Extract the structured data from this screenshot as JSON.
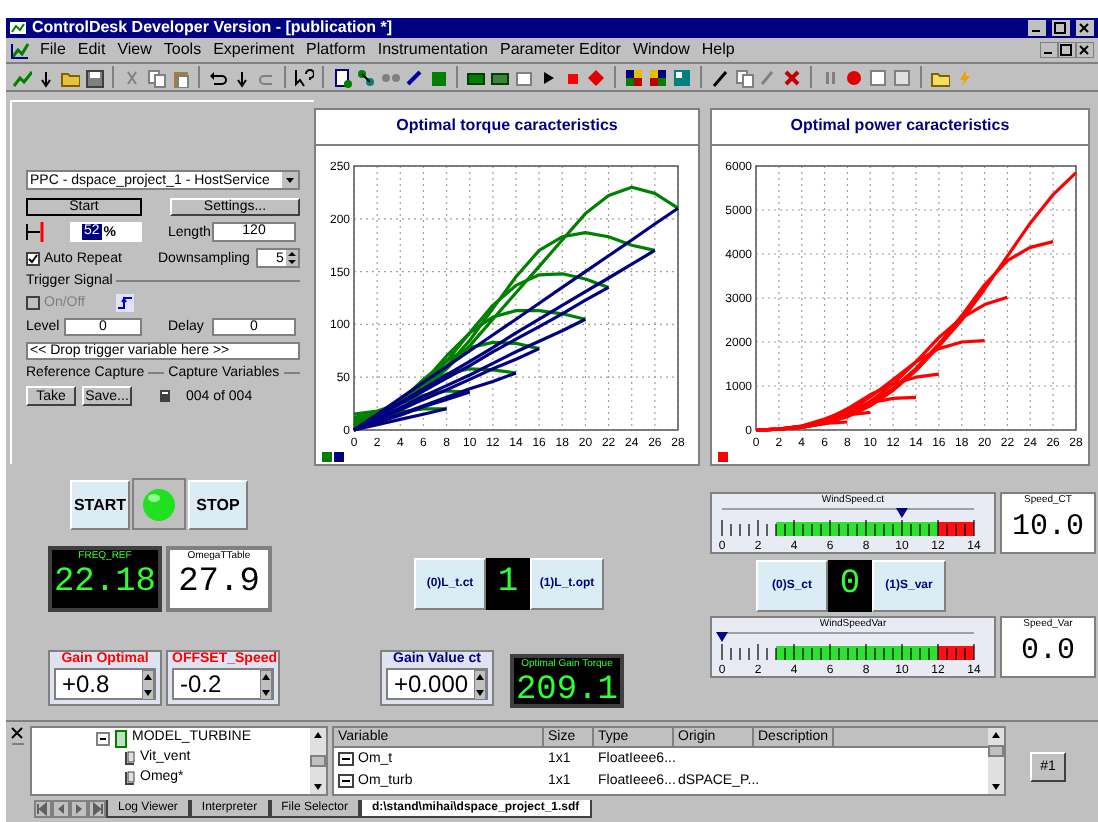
{
  "window": {
    "title": "ControlDesk Developer Version - [publication *]"
  },
  "menu": [
    "File",
    "Edit",
    "View",
    "Tools",
    "Experiment",
    "Platform",
    "Instrumentation",
    "Parameter Editor",
    "Window",
    "Help"
  ],
  "capture": {
    "platform": "PPC - dspace_project_1 - HostService",
    "start": "Start",
    "settings": "Settings...",
    "progress": {
      "value": "52",
      "unit": "%"
    },
    "length": {
      "label": "Length",
      "value": "120"
    },
    "auto_repeat": {
      "label": "Auto Repeat",
      "checked": true
    },
    "downsampling": {
      "label": "Downsampling",
      "value": "5"
    },
    "trigger": {
      "title": "Trigger Signal",
      "on_off": {
        "label": "On/Off",
        "checked": false,
        "disabled": true
      },
      "level": {
        "label": "Level",
        "value": "0"
      },
      "delay": {
        "label": "Delay",
        "value": "0"
      },
      "drop_zone": "<< Drop trigger variable here >>"
    },
    "reference": {
      "title": "Reference Capture",
      "take": "Take",
      "save": "Save..."
    },
    "variables": {
      "title": "Capture Variables",
      "count": "004 of 004"
    }
  },
  "charts": [
    {
      "chart_data": {
        "type": "line",
        "title": "Optimal torque caracteristics",
        "x": [
          0,
          2,
          4,
          6,
          8,
          10,
          12,
          14,
          16,
          18,
          20,
          22,
          24,
          26,
          28
        ],
        "xlim": [
          0,
          28
        ],
        "ylim": [
          0,
          250
        ],
        "xticks": [
          0,
          2,
          4,
          6,
          8,
          10,
          12,
          14,
          16,
          18,
          20,
          22,
          24,
          26,
          28
        ],
        "yticks": [
          0,
          50,
          100,
          150,
          200,
          250
        ],
        "grid": true,
        "series": [
          {
            "color": "#008000",
            "values": [
              15,
              18,
              25,
              40,
              58,
              80,
              105,
              130,
              155,
              180,
              205,
              222,
              230,
              224,
              210
            ]
          },
          {
            "color": "#008000",
            "values": [
              12,
              16,
              25,
              40,
              60,
              85,
              115,
              145,
              170,
              183,
              187,
              183,
              175,
              170,
              null
            ]
          },
          {
            "color": "#008000",
            "values": [
              10,
              15,
              25,
              42,
              65,
              92,
              118,
              137,
              147,
              148,
              143,
              135,
              null,
              null,
              null
            ]
          },
          {
            "color": "#008000",
            "values": [
              8,
              14,
              26,
              45,
              70,
              92,
              107,
              113,
              113,
              110,
              105,
              null,
              null,
              null,
              null
            ]
          },
          {
            "color": "#008000",
            "values": [
              6,
              13,
              27,
              48,
              66,
              78,
              83,
              82,
              77,
              null,
              null,
              null,
              null,
              null,
              null
            ]
          },
          {
            "color": "#008000",
            "values": [
              5,
              13,
              28,
              43,
              53,
              58,
              57,
              54,
              null,
              null,
              null,
              null,
              null,
              null,
              null
            ]
          },
          {
            "color": "#008000",
            "values": [
              4,
              13,
              25,
              33,
              37,
              36,
              null,
              null,
              null,
              null,
              null,
              null,
              null,
              null,
              null
            ]
          },
          {
            "color": "#008000",
            "values": [
              3,
              11,
              17,
              20,
              20,
              null,
              null,
              null,
              null,
              null,
              null,
              null,
              null,
              null,
              null
            ]
          },
          {
            "color": "#000080",
            "values": [
              0,
              15,
              30,
              45,
              60,
              75,
              90,
              105,
              120,
              135,
              150,
              165,
              180,
              195,
              210
            ]
          },
          {
            "color": "#000080",
            "values": [
              0,
              13,
              26,
              39,
              52,
              65,
              78,
              92,
              105,
              118,
              131,
              144,
              157,
              170,
              null
            ]
          },
          {
            "color": "#000080",
            "values": [
              0,
              12,
              25,
              37,
              49,
              61,
              74,
              86,
              98,
              110,
              123,
              135,
              null,
              null,
              null
            ]
          },
          {
            "color": "#000080",
            "values": [
              0,
              10,
              21,
              32,
              42,
              52,
              63,
              74,
              84,
              94,
              105,
              null,
              null,
              null,
              null
            ]
          },
          {
            "color": "#000080",
            "values": [
              0,
              10,
              19,
              29,
              38,
              48,
              58,
              67,
              77,
              null,
              null,
              null,
              null,
              null,
              null
            ]
          },
          {
            "color": "#000080",
            "values": [
              0,
              8,
              15,
              23,
              31,
              39,
              46,
              54,
              null,
              null,
              null,
              null,
              null,
              null,
              null
            ]
          },
          {
            "color": "#000080",
            "values": [
              0,
              7,
              14,
              22,
              29,
              36,
              null,
              null,
              null,
              null,
              null,
              null,
              null,
              null,
              null
            ]
          },
          {
            "color": "#000080",
            "values": [
              0,
              5,
              10,
              15,
              20,
              null,
              null,
              null,
              null,
              null,
              null,
              null,
              null,
              null,
              null
            ]
          }
        ]
      }
    },
    {
      "chart_data": {
        "type": "line",
        "title": "Optimal power caracteristics",
        "x": [
          0,
          2,
          4,
          6,
          8,
          10,
          12,
          14,
          16,
          18,
          20,
          22,
          24,
          26,
          28
        ],
        "xlim": [
          0,
          28
        ],
        "ylim": [
          0,
          6000
        ],
        "xticks": [
          0,
          2,
          4,
          6,
          8,
          10,
          12,
          14,
          16,
          18,
          20,
          22,
          24,
          26,
          28
        ],
        "yticks": [
          0,
          1000,
          2000,
          3000,
          4000,
          5000,
          6000
        ],
        "grid": true,
        "series": [
          {
            "color": "#ff0000",
            "values": [
              0,
              20,
              60,
              150,
              300,
              550,
              900,
              1350,
              1900,
              2500,
              3200,
              3950,
              4700,
              5350,
              5850
            ]
          },
          {
            "color": "#ff0000",
            "values": [
              0,
              20,
              60,
              150,
              320,
              600,
              950,
              1400,
              1950,
              2600,
              3300,
              3850,
              4150,
              4280,
              null
            ]
          },
          {
            "color": "#ff0000",
            "values": [
              0,
              20,
              60,
              160,
              350,
              650,
              1050,
              1550,
              2100,
              2550,
              2850,
              3020,
              null,
              null,
              null
            ]
          },
          {
            "color": "#ff0000",
            "values": [
              0,
              20,
              70,
              180,
              400,
              750,
              1150,
              1550,
              1850,
              2000,
              2030,
              null,
              null,
              null,
              null
            ]
          },
          {
            "color": "#ff0000",
            "values": [
              0,
              20,
              80,
              220,
              480,
              800,
              1050,
              1200,
              1270,
              null,
              null,
              null,
              null,
              null,
              null
            ]
          },
          {
            "color": "#ff0000",
            "values": [
              0,
              20,
              90,
              250,
              450,
              620,
              720,
              740,
              null,
              null,
              null,
              null,
              null,
              null,
              null
            ]
          },
          {
            "color": "#ff0000",
            "values": [
              0,
              20,
              90,
              220,
              340,
              400,
              null,
              null,
              null,
              null,
              null,
              null,
              null,
              null,
              null
            ]
          },
          {
            "color": "#ff0000",
            "values": [
              0,
              20,
              80,
              150,
              180,
              null,
              null,
              null,
              null,
              null,
              null,
              null,
              null,
              null,
              null
            ]
          }
        ]
      }
    }
  ],
  "run_controls": {
    "start": "START",
    "led_on": true,
    "stop": "STOP"
  },
  "freq_display": {
    "label": "FREQ_REF",
    "value": "22.18"
  },
  "omega_display": {
    "label": "OmegaTTable",
    "value": "27.9"
  },
  "torque_switch": {
    "option_0": "(0)L_t.ct",
    "value": "1",
    "option_1": "(1)L_t.opt"
  },
  "speed_switch": {
    "option_0": "(0)S_ct",
    "value": "0",
    "option_1": "(1)S_var"
  },
  "gauges": [
    {
      "title": "WindSpeed.ct",
      "level": 0.714,
      "ticks": [
        "0",
        "2",
        "4",
        "6",
        "8",
        "10",
        "12",
        "14"
      ],
      "readout_label": "Speed_CT",
      "readout": "10.0"
    },
    {
      "title": "WindSpeedVar",
      "level": 0,
      "ticks": [
        "0",
        "2",
        "4",
        "6",
        "8",
        "10",
        "12",
        "14"
      ],
      "readout_label": "Speed_Var",
      "readout": "0.0"
    }
  ],
  "inputs": [
    {
      "label": "Gain Optimal",
      "color": "#ff0000",
      "value": "+0.8"
    },
    {
      "label": "OFFSET_Speed",
      "color": "#ff0000",
      "value": "-0.2"
    },
    {
      "label": "Gain Value ct",
      "color": "#000080",
      "value": "+0.000"
    }
  ],
  "gain_display": {
    "label": "Optimal Gain Torque",
    "value": "209.1"
  },
  "tree": [
    {
      "label": "MODEL_TURBINE",
      "expanded": true,
      "children": [
        {
          "label": "Vit_vent"
        },
        {
          "label": "Omeg*"
        }
      ]
    }
  ],
  "variables_table": {
    "columns": [
      "Variable",
      "Size",
      "Type",
      "Origin",
      "Description"
    ],
    "rows": [
      {
        "variable": "Om_t",
        "size": "1x1",
        "type": "FloatIeee6..."
      },
      {
        "variable": "Om_turb",
        "size": "1x1",
        "type": "FloatIeee6...",
        "origin": "dSPACE_P..."
      }
    ]
  },
  "side_button": "#1",
  "tabs": [
    {
      "label": "Log Viewer",
      "selected": false
    },
    {
      "label": "Interpreter",
      "selected": false
    },
    {
      "label": "File Selector",
      "selected": false
    },
    {
      "label": "d:\\stand\\mihai\\dspace_project_1.sdf",
      "selected": true
    }
  ]
}
